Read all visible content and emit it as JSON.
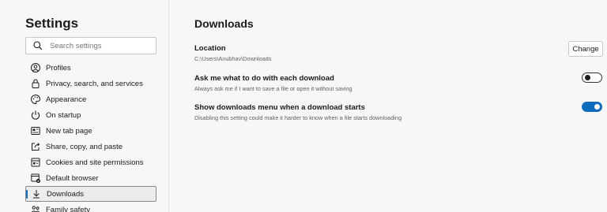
{
  "sidebar": {
    "title": "Settings",
    "search_placeholder": "Search settings",
    "items": [
      {
        "label": "Profiles",
        "icon": "profile-icon"
      },
      {
        "label": "Privacy, search, and services",
        "icon": "lock-icon"
      },
      {
        "label": "Appearance",
        "icon": "palette-icon"
      },
      {
        "label": "On startup",
        "icon": "power-icon"
      },
      {
        "label": "New tab page",
        "icon": "new-tab-icon"
      },
      {
        "label": "Share, copy, and paste",
        "icon": "share-icon"
      },
      {
        "label": "Cookies and site permissions",
        "icon": "cookies-icon"
      },
      {
        "label": "Default browser",
        "icon": "browser-icon"
      },
      {
        "label": "Downloads",
        "icon": "download-icon",
        "active": true
      },
      {
        "label": "Family safety",
        "icon": "family-icon"
      }
    ]
  },
  "main": {
    "title": "Downloads",
    "location": {
      "title": "Location",
      "path": "C:\\Users\\Anubhav\\Downloads",
      "button_label": "Change"
    },
    "ask_setting": {
      "title": "Ask me what to do with each download",
      "description": "Always ask me if I want to save a file or open it without saving",
      "enabled": false
    },
    "menu_setting": {
      "title": "Show downloads menu when a download starts",
      "description": "Disabling this setting could make it harder to know when a file starts downloading",
      "enabled": true
    }
  },
  "colors": {
    "accent": "#0f6cbd",
    "background": "#f7f7f7"
  }
}
